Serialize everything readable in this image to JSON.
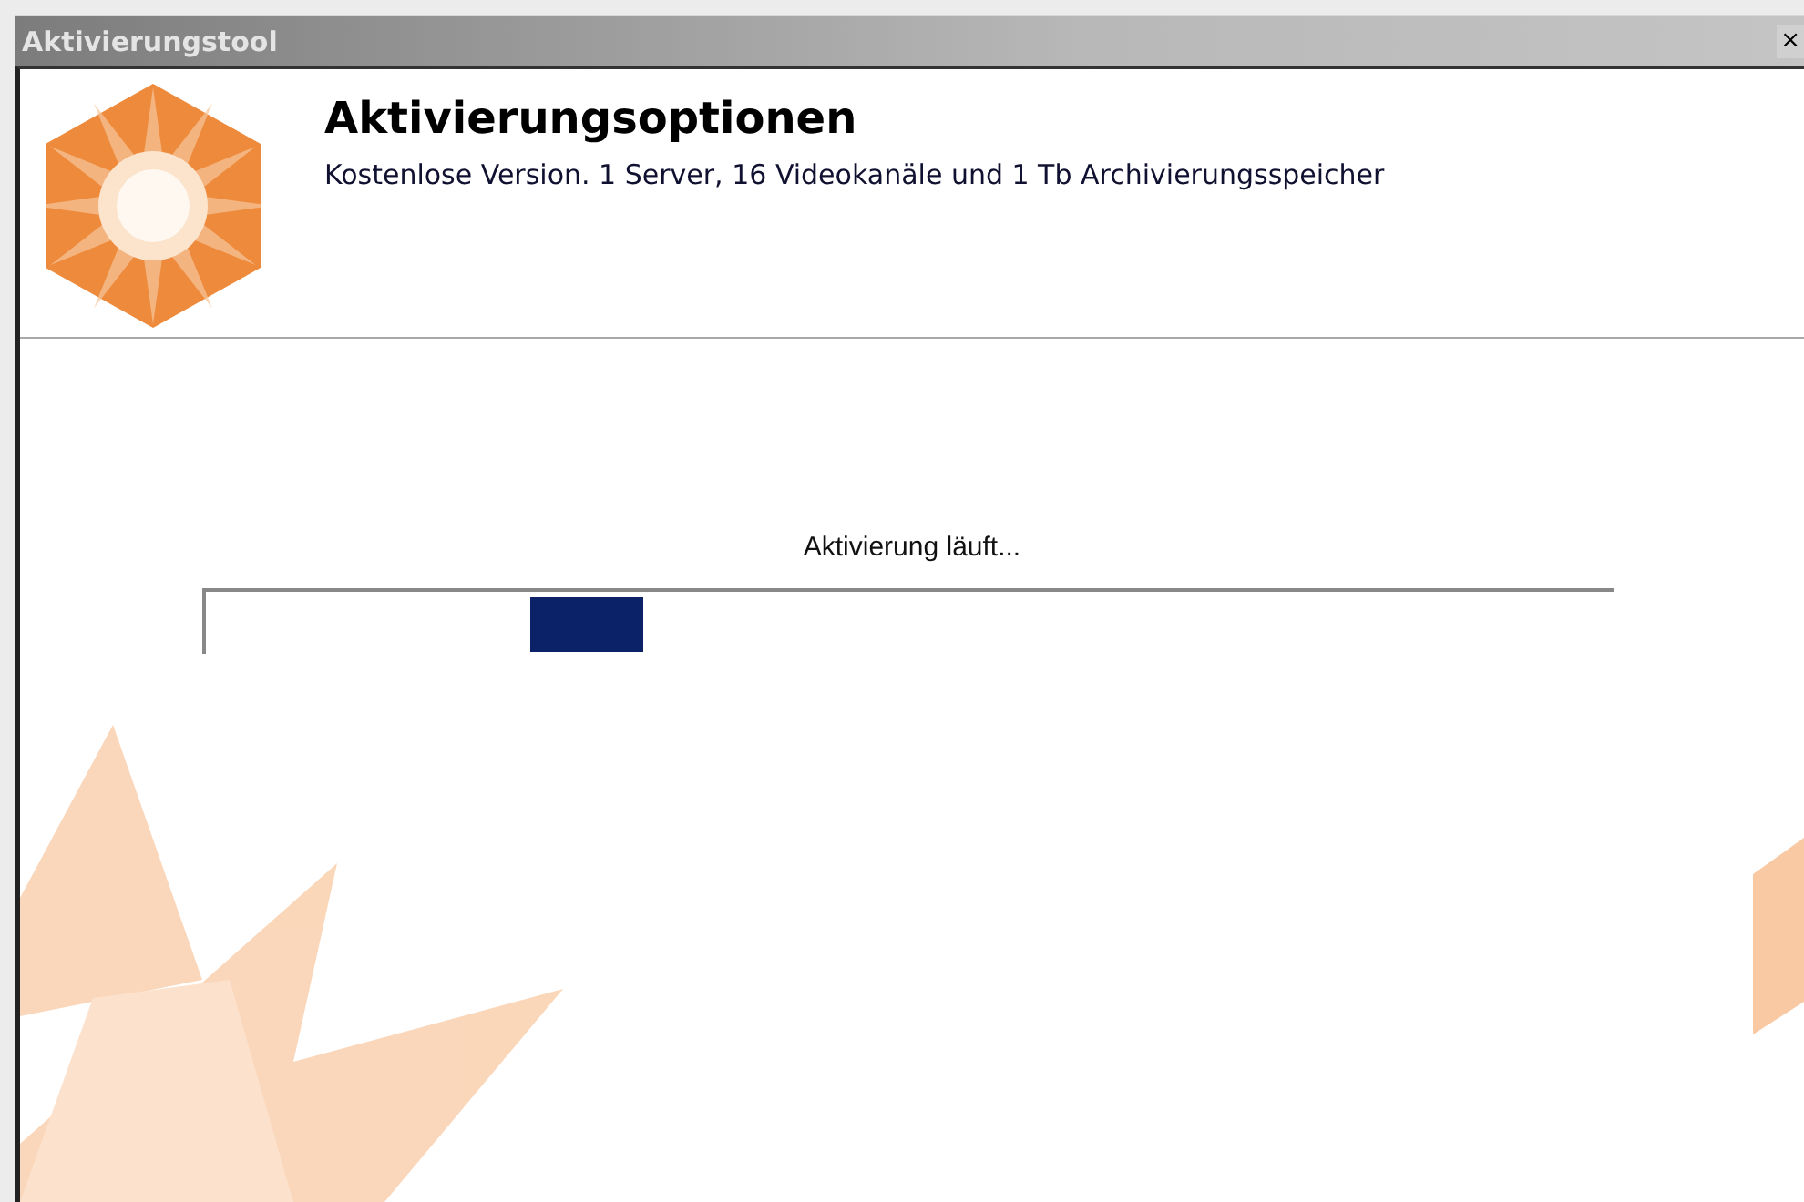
{
  "window": {
    "title": "Aktivierungstool",
    "close": "×"
  },
  "header": {
    "title": "Aktivierungsoptionen",
    "subtitle": "Kostenlose Version. 1 Server, 16 Videokanäle und 1 Tb Archivierungsspeicher"
  },
  "progress": {
    "label": "Aktivierung läuft...",
    "level": 0.31
  }
}
